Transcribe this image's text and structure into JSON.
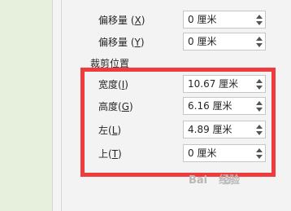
{
  "offset_x": {
    "label": "偏移量 ",
    "mnemonic": "X",
    "key_open": "(",
    "key_close": ")",
    "value": "0 厘米"
  },
  "offset_y": {
    "label": "偏移量 ",
    "mnemonic": "Y",
    "key_open": "(",
    "key_close": ")",
    "value": "0 厘米"
  },
  "crop_section_title": "裁剪位置",
  "crop_fields": {
    "width": {
      "label": "宽度",
      "mnemonic": "I",
      "value": "10.67 厘米"
    },
    "height": {
      "label": "高度",
      "mnemonic": "G",
      "value": "6.16 厘米"
    },
    "left": {
      "label": "左",
      "mnemonic": "L",
      "value": "4.89 厘米"
    },
    "top": {
      "label": "上",
      "mnemonic": "T",
      "value": "0 厘米"
    }
  },
  "watermark": {
    "brand": "Bai",
    "text": "经验"
  },
  "colors": {
    "highlight": "#ef3b3b",
    "panel": "#f3f3f3",
    "left_strip": "#e6f0dc"
  }
}
